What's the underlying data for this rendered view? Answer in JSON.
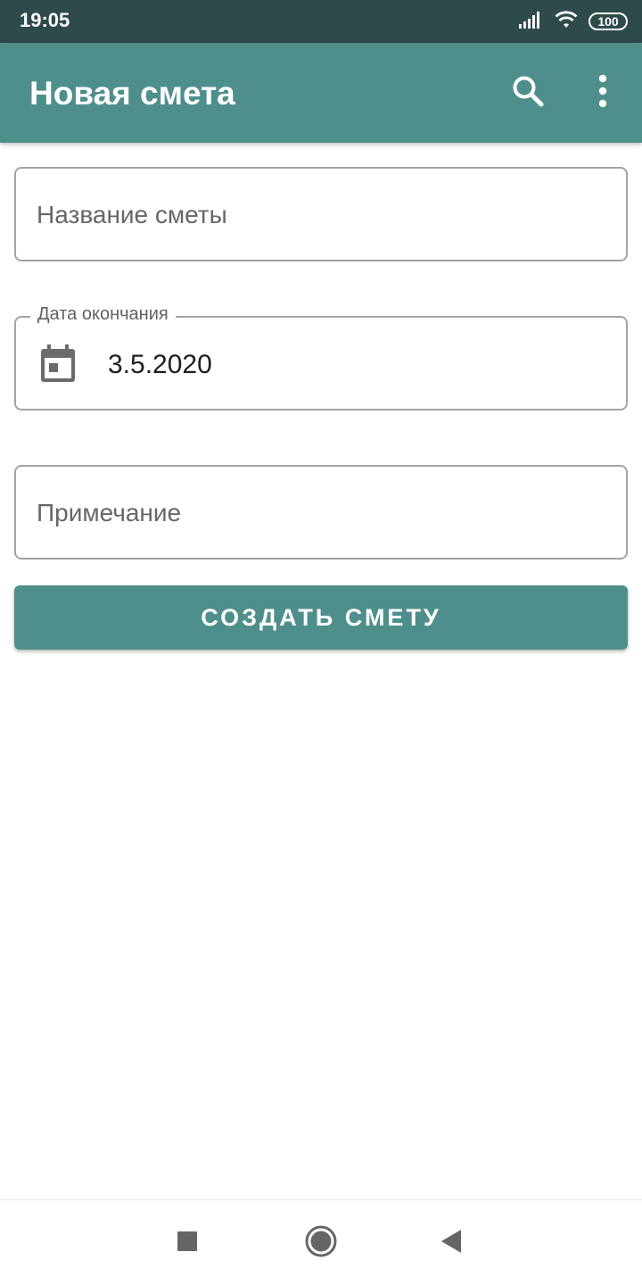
{
  "status_bar": {
    "time": "19:05",
    "battery": "100",
    "icons": [
      "signal-icon",
      "wifi-icon",
      "battery-icon"
    ]
  },
  "app_bar": {
    "title": "Новая смета",
    "background": "#4f8f8b",
    "actions": [
      "search-icon",
      "more-vert-icon"
    ]
  },
  "form": {
    "name_field": {
      "placeholder": "Название сметы",
      "value": ""
    },
    "end_date_field": {
      "label": "Дата окончания",
      "value": "3.5.2020",
      "icon": "calendar-icon"
    },
    "note_field": {
      "placeholder": "Примечание",
      "value": ""
    },
    "submit_label": "СОЗДАТЬ СМЕТУ"
  },
  "nav_bar": {
    "buttons": [
      "recents-square-icon",
      "home-circle-icon",
      "back-triangle-icon"
    ]
  },
  "colors": {
    "accent": "#4f8f8b",
    "status_bar": "#2f4a4a",
    "field_border": "#a3a3a3"
  }
}
